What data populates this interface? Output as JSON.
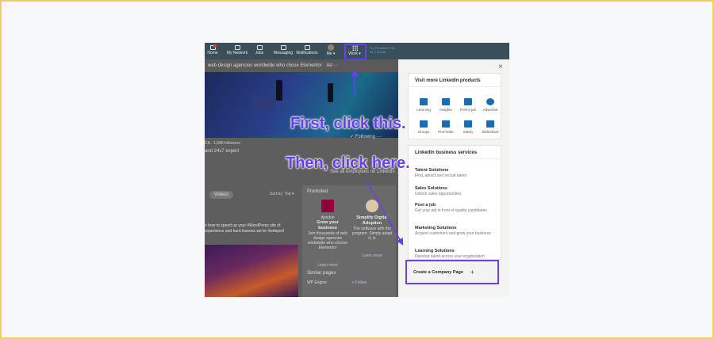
{
  "nav": {
    "items": [
      {
        "name": "home",
        "label": "Home"
      },
      {
        "name": "my-network",
        "label": "My Network"
      },
      {
        "name": "jobs",
        "label": "Jobs"
      },
      {
        "name": "messaging",
        "label": "Messaging"
      },
      {
        "name": "notifications",
        "label": "Notifications"
      },
      {
        "name": "me",
        "label": "Me ▾"
      },
      {
        "name": "work",
        "label": "Work ▾"
      }
    ],
    "premium": "Try Premium Free for 1 Month"
  },
  "background": {
    "strip_text": "web design agencies worldwide who chose Elementor",
    "ad_label": "Ad ···",
    "meta_line": "CA · 1,686 followers",
    "meta_line2": "and 24x7 expert",
    "following": "✓ Following   ···",
    "see_employees": "See all employees on LinkedIn →",
    "videos_tab": "Videos",
    "sort_by": "Sort by: Top ▾",
    "feed_text": "n how to speed up your #WordPress site of experience and hard lessons we've #webperf",
    "promoted": {
      "header": "Promoted",
      "ads": [
        {
          "brand": "djwebin",
          "title": "Grow your business",
          "desc": "Join thousands of web design agencies worldwide who choose Elementor",
          "cta": "Learn more"
        },
        {
          "brand": "",
          "title": "Simplify Digital Adoption",
          "desc": "The software with the program. Simply adapt it, in",
          "cta": "Learn more"
        }
      ]
    },
    "similar": {
      "header": "Similar pages",
      "item": "WP Engine",
      "follow": "+ Follow"
    }
  },
  "panel": {
    "close": "×",
    "products_title": "Visit more LinkedIn products",
    "products": [
      {
        "label": "Learning",
        "color": "#1a6bb0"
      },
      {
        "label": "Insights",
        "color": "#1a6bb0"
      },
      {
        "label": "Post a job",
        "color": "#1a6bb0"
      },
      {
        "label": "Advertise",
        "color": "#1a6bb0"
      },
      {
        "label": "Groups",
        "color": "#1a6bb0"
      },
      {
        "label": "ProFinder",
        "color": "#1a6bb0"
      },
      {
        "label": "Salary",
        "color": "#1a6bb0"
      },
      {
        "label": "Slideshare",
        "color": "#1a6bb0"
      }
    ],
    "services_title": "LinkedIn business services",
    "services": [
      {
        "title": "Talent Solutions",
        "desc": "Find, attract and recruit talent"
      },
      {
        "title": "Sales Solutions",
        "desc": "Unlock sales opportunities"
      },
      {
        "title": "Post a job",
        "desc": "Get your job in front of quality candidates"
      },
      {
        "title": "Marketing Solutions",
        "desc": "Acquire customers and grow your business"
      },
      {
        "title": "Learning Solutions",
        "desc": "Develop talent across your organization"
      }
    ],
    "create_company": "Create a Company Page",
    "create_plus": "+"
  },
  "annotations": {
    "first": "First, click this.",
    "then": "Then, click here.",
    "color": "#6a3ff0"
  }
}
